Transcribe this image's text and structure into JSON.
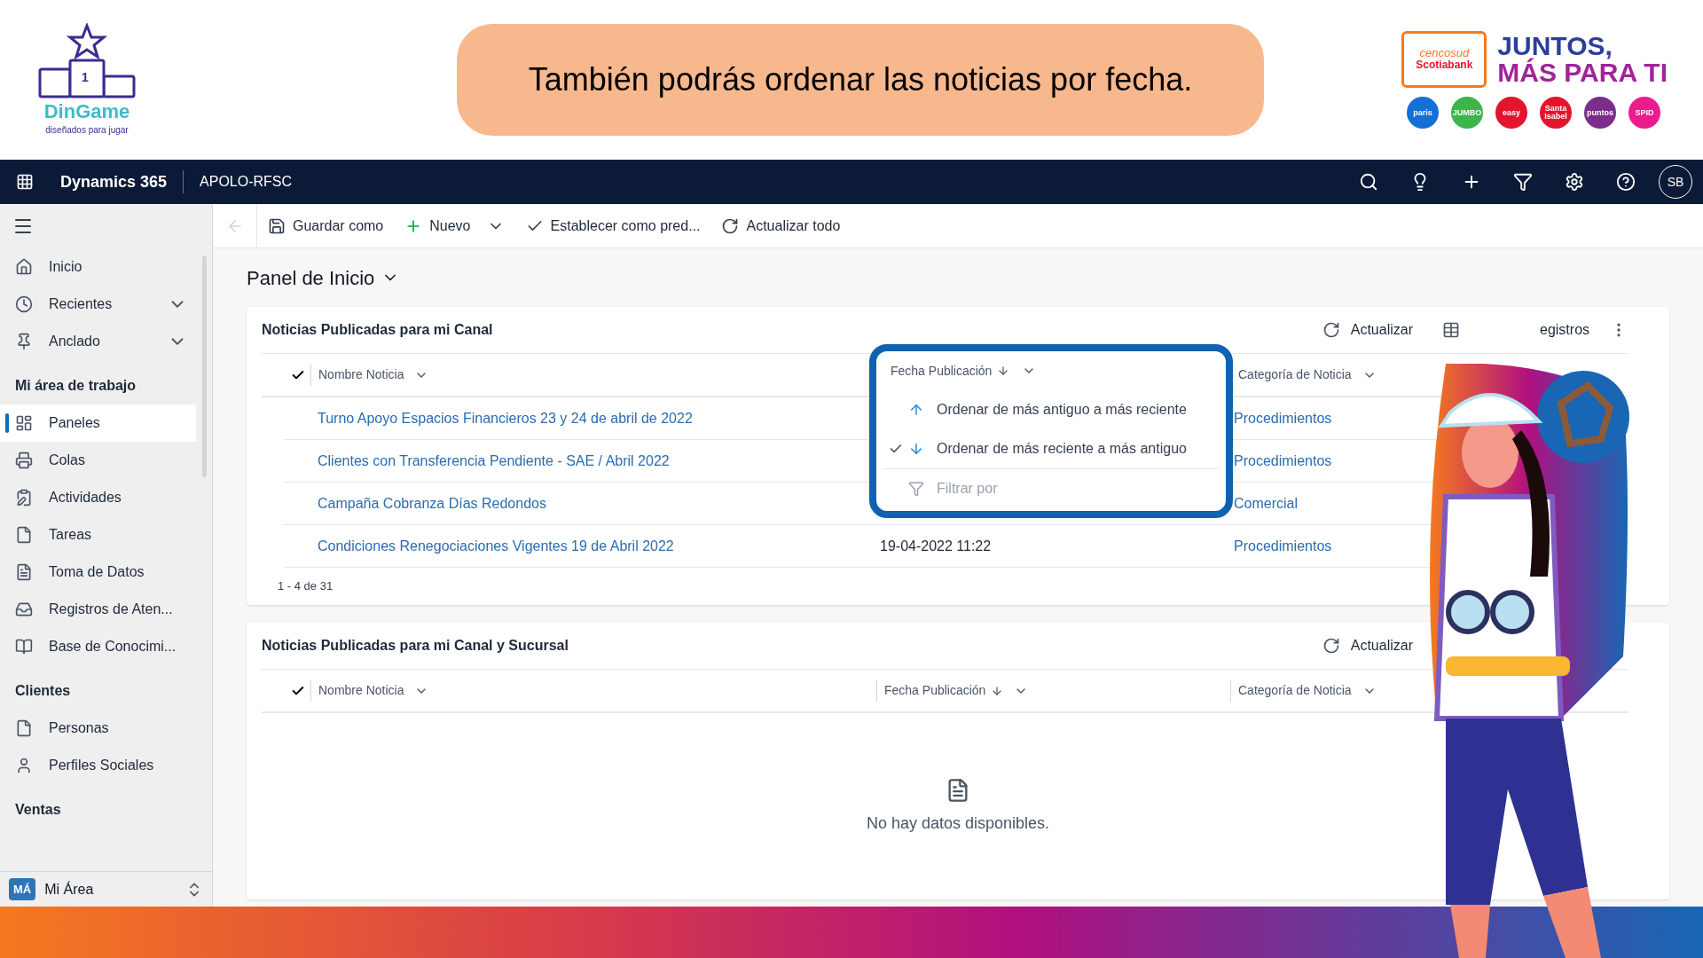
{
  "banner": {
    "logo": {
      "number": "1",
      "name": "DinGame",
      "tagline": "diseñados para jugar"
    },
    "message": "También podrás ordenar las noticias por fecha.",
    "partner": {
      "badge_top": "cencosud",
      "badge_bottom": "Scotiabank",
      "slogan_1": "JUNTOS,",
      "slogan_2": "MÁS PARA TI"
    },
    "stores": [
      {
        "label": "paris",
        "color": "#1570d6"
      },
      {
        "label": "JUMBO",
        "color": "#3cb54a"
      },
      {
        "label": "easy",
        "color": "#e3142d"
      },
      {
        "label": "Santa Isabel",
        "color": "#e3142d"
      },
      {
        "label": "puntos",
        "color": "#7b2d8b"
      },
      {
        "label": "SPID",
        "color": "#ec1c8c"
      }
    ]
  },
  "navbar": {
    "app": "Dynamics 365",
    "environment": "APOLO-RFSC",
    "avatar": "SB"
  },
  "sidebar": {
    "items": [
      {
        "kind": "item",
        "label": "Inicio",
        "selected": false
      },
      {
        "kind": "item",
        "label": "Recientes",
        "selected": false,
        "expandable": true
      },
      {
        "kind": "item",
        "label": "Anclado",
        "selected": false,
        "expandable": true
      },
      {
        "kind": "section",
        "label": "Mi área de trabajo"
      },
      {
        "kind": "item",
        "label": "Paneles",
        "selected": true
      },
      {
        "kind": "item",
        "label": "Colas",
        "selected": false
      },
      {
        "kind": "item",
        "label": "Actividades",
        "selected": false
      },
      {
        "kind": "item",
        "label": "Tareas",
        "selected": false
      },
      {
        "kind": "item",
        "label": "Toma de Datos",
        "selected": false
      },
      {
        "kind": "item",
        "label": "Registros de Aten...",
        "selected": false
      },
      {
        "kind": "item",
        "label": "Base de Conocimi...",
        "selected": false
      },
      {
        "kind": "section",
        "label": "Clientes"
      },
      {
        "kind": "item",
        "label": "Personas",
        "selected": false
      },
      {
        "kind": "item",
        "label": "Perfiles Sociales",
        "selected": false
      },
      {
        "kind": "section",
        "label": "Ventas"
      }
    ],
    "area": {
      "badge": "MÁ",
      "label": "Mi Área"
    }
  },
  "toolbar": [
    {
      "label": "Guardar como"
    },
    {
      "label": "Nuevo",
      "menu": true
    },
    {
      "label": "Establecer como pred..."
    },
    {
      "label": "Actualizar todo"
    }
  ],
  "page_title": "Panel de Inicio",
  "panels": [
    {
      "title": "Noticias Publicadas para mi Canal",
      "refresh": "Actualizar",
      "records": "egistros",
      "columns": [
        "Nombre Noticia",
        "Fecha Publicación",
        "Categoría de Noticia"
      ],
      "rows": [
        {
          "name": "Turno Apoyo Espacios Financieros 23 y 24 de abril de 2022",
          "category": "Procedimientos"
        },
        {
          "name": "Clientes con Transferencia Pendiente - SAE / Abril 2022",
          "category": "Procedimientos"
        },
        {
          "name": "Campaña Cobranza Días Redondos",
          "category": "Comercial"
        },
        {
          "name": "Condiciones Renegociaciones Vigentes 19 de Abril 2022",
          "date": "19-04-2022 11:22",
          "category": "Procedimientos"
        }
      ],
      "footer": "1 - 4 de 31",
      "sort_menu": {
        "options": [
          {
            "kind": "ascending",
            "label": "Ordenar de más antiguo a más reciente",
            "selected": false
          },
          {
            "kind": "descending",
            "label": "Ordenar de más reciente a más antiguo",
            "selected": true
          },
          {
            "kind": "filter",
            "label": "Filtrar por",
            "disabled": true
          }
        ]
      }
    },
    {
      "title": "Noticias Publicadas para mi Canal y Sucursal",
      "refresh": "Actualizar",
      "columns": [
        "Nombre Noticia",
        "Fecha Publicación",
        "Categoría de Noticia"
      ],
      "empty": "No hay datos disponibles."
    }
  ]
}
